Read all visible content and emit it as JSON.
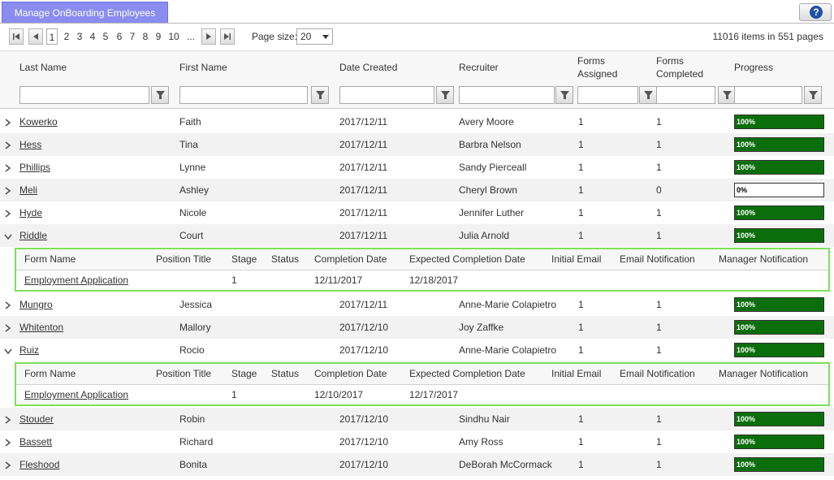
{
  "tab": {
    "label": "Manage OnBoarding Employees"
  },
  "help": {
    "label": "?"
  },
  "pager": {
    "pages": [
      "1",
      "2",
      "3",
      "4",
      "5",
      "6",
      "7",
      "8",
      "9",
      "10",
      "..."
    ],
    "page_size_label": "Page size:",
    "page_size": "20",
    "info": "11016 items in 551 pages"
  },
  "columns": {
    "last_name": "Last Name",
    "first_name": "First Name",
    "date_created": "Date Created",
    "recruiter": "Recruiter",
    "forms_assigned": "Forms Assigned",
    "forms_completed": "Forms Completed",
    "progress": "Progress"
  },
  "detail_columns": {
    "form_name": "Form Name",
    "position_title": "Position Title",
    "stage": "Stage",
    "status": "Status",
    "completion_date": "Completion Date",
    "expected_completion_date": "Expected Completion Date",
    "initial_email": "Initial Email",
    "email_notification": "Email Notification",
    "manager_notification": "Manager Notification"
  },
  "rows": [
    {
      "last": "Kowerko",
      "first": "Faith",
      "date": "2017/12/11",
      "recruiter": "Avery Moore",
      "assigned": "1",
      "completed": "1",
      "progress": "100%",
      "progress_value": 100,
      "expanded": false
    },
    {
      "last": "Hess",
      "first": "Tina",
      "date": "2017/12/11",
      "recruiter": "Barbra Nelson",
      "assigned": "1",
      "completed": "1",
      "progress": "100%",
      "progress_value": 100,
      "expanded": false
    },
    {
      "last": "Phillips",
      "first": "Lynne",
      "date": "2017/12/11",
      "recruiter": "Sandy Pierceall",
      "assigned": "1",
      "completed": "1",
      "progress": "100%",
      "progress_value": 100,
      "expanded": false
    },
    {
      "last": "Meli",
      "first": "Ashley",
      "date": "2017/12/11",
      "recruiter": "Cheryl Brown",
      "assigned": "1",
      "completed": "0",
      "progress": "0%",
      "progress_value": 0,
      "expanded": false
    },
    {
      "last": "Hyde",
      "first": "Nicole",
      "date": "2017/12/11",
      "recruiter": "Jennifer Luther",
      "assigned": "1",
      "completed": "1",
      "progress": "100%",
      "progress_value": 100,
      "expanded": false
    },
    {
      "last": "Riddle",
      "first": "Court",
      "date": "2017/12/11",
      "recruiter": "Julia Arnold",
      "assigned": "1",
      "completed": "1",
      "progress": "100%",
      "progress_value": 100,
      "expanded": true,
      "detail": {
        "form_name": "Employment Application",
        "position_title": "",
        "stage": "1",
        "status": "",
        "completion_date": "12/11/2017",
        "expected_completion_date": "12/18/2017",
        "initial_email": "",
        "email_notification": "",
        "manager_notification": ""
      }
    },
    {
      "last": "Mungro",
      "first": "Jessica",
      "date": "2017/12/11",
      "recruiter": "Anne-Marie Colapietro",
      "assigned": "1",
      "completed": "1",
      "progress": "100%",
      "progress_value": 100,
      "expanded": false
    },
    {
      "last": "Whitenton",
      "first": "Mallory",
      "date": "2017/12/10",
      "recruiter": "Joy Zaffke",
      "assigned": "1",
      "completed": "1",
      "progress": "100%",
      "progress_value": 100,
      "expanded": false
    },
    {
      "last": "Ruiz",
      "first": "Rocio",
      "date": "2017/12/10",
      "recruiter": "Anne-Marie Colapietro",
      "assigned": "1",
      "completed": "1",
      "progress": "100%",
      "progress_value": 100,
      "expanded": true,
      "detail": {
        "form_name": "Employment Application",
        "position_title": "",
        "stage": "1",
        "status": "",
        "completion_date": "12/10/2017",
        "expected_completion_date": "12/17/2017",
        "initial_email": "",
        "email_notification": "",
        "manager_notification": ""
      }
    },
    {
      "last": "Stouder",
      "first": "Robin",
      "date": "2017/12/10",
      "recruiter": "Sindhu Nair",
      "assigned": "1",
      "completed": "1",
      "progress": "100%",
      "progress_value": 100,
      "expanded": false
    },
    {
      "last": "Bassett",
      "first": "Richard",
      "date": "2017/12/10",
      "recruiter": "Amy Ross",
      "assigned": "1",
      "completed": "1",
      "progress": "100%",
      "progress_value": 100,
      "expanded": false
    },
    {
      "last": "Fleshood",
      "first": "Bonita",
      "date": "2017/12/10",
      "recruiter": "DeBorah McCormack",
      "assigned": "1",
      "completed": "1",
      "progress": "100%",
      "progress_value": 100,
      "expanded": false
    }
  ],
  "colors": {
    "tab": "#8a8cf0",
    "progress_fill": "#0a6e0a",
    "detail_border": "#7ee05a"
  }
}
